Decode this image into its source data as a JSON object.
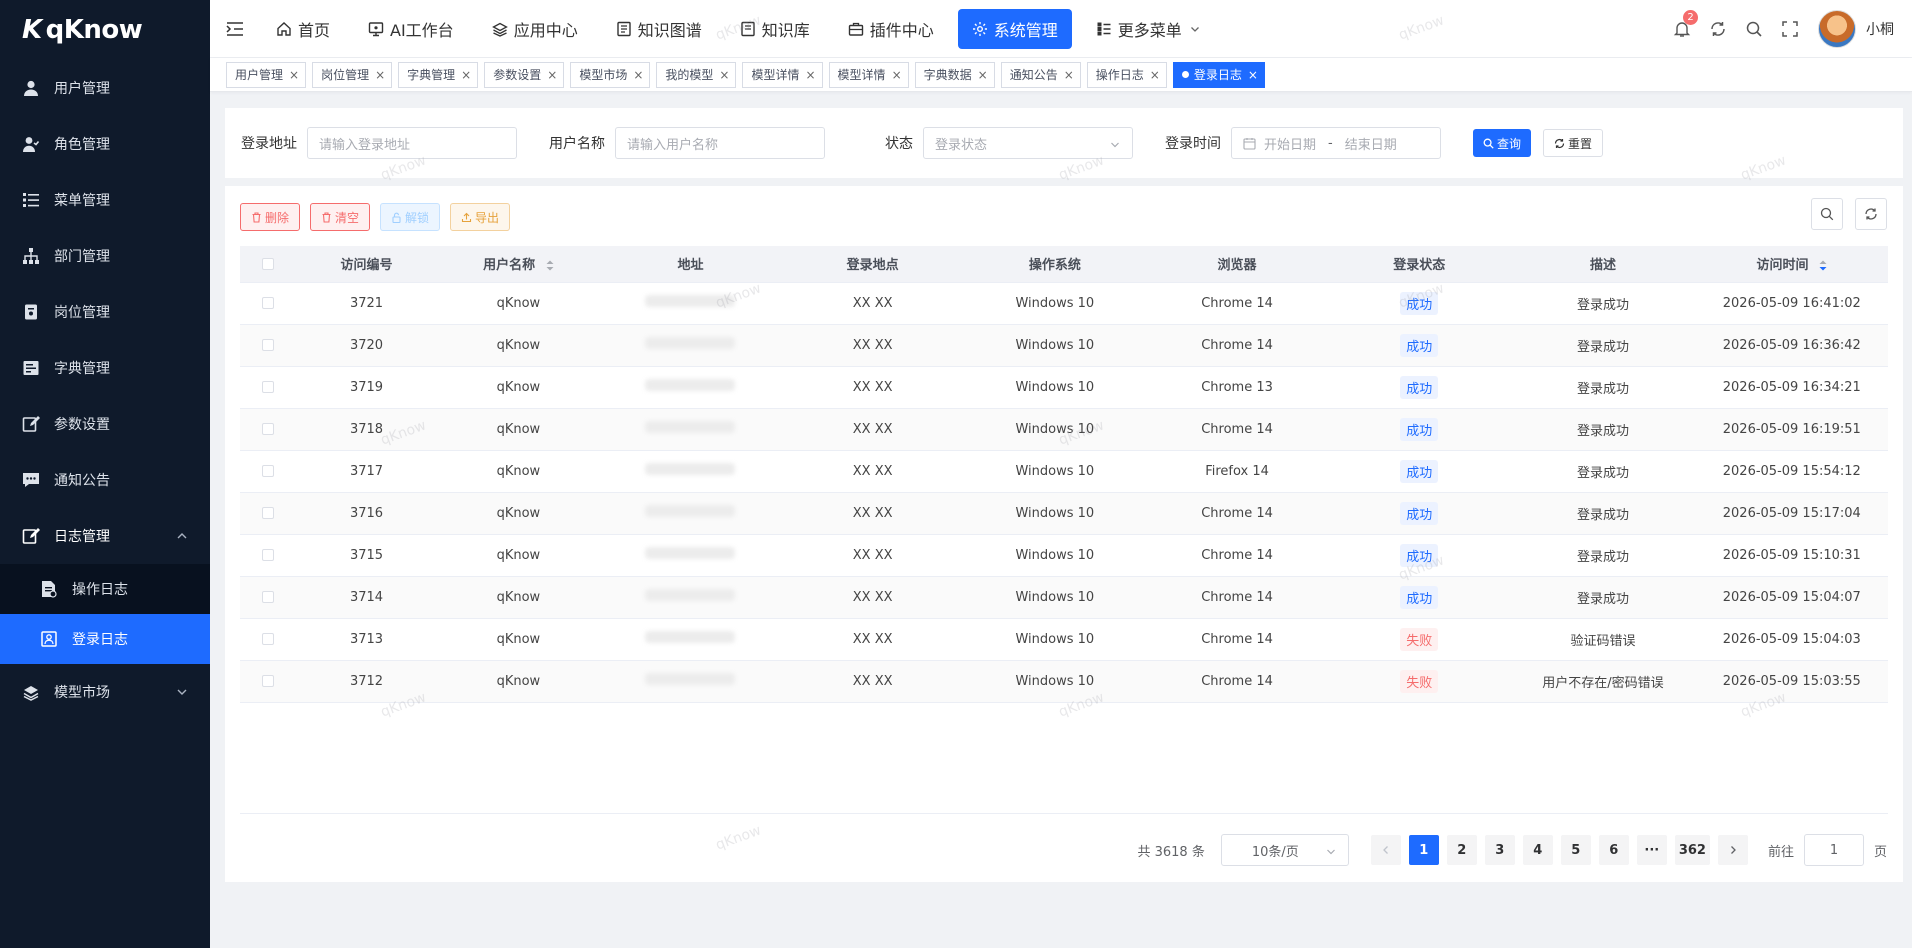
{
  "app": {
    "logo_text": "qKnow",
    "logo_mark": "K"
  },
  "sidebar": {
    "items": [
      {
        "label": "用户管理",
        "icon": "user-icon"
      },
      {
        "label": "角色管理",
        "icon": "role-icon"
      },
      {
        "label": "菜单管理",
        "icon": "menu-icon"
      },
      {
        "label": "部门管理",
        "icon": "department-icon"
      },
      {
        "label": "岗位管理",
        "icon": "post-icon"
      },
      {
        "label": "字典管理",
        "icon": "dictionary-icon"
      },
      {
        "label": "参数设置",
        "icon": "edit-icon"
      },
      {
        "label": "通知公告",
        "icon": "message-icon"
      }
    ],
    "log_group": {
      "label": "日志管理",
      "children": [
        {
          "label": "操作日志"
        },
        {
          "label": "登录日志"
        }
      ]
    },
    "model_market": {
      "label": "模型市场"
    }
  },
  "topnav": {
    "items": [
      {
        "label": "首页"
      },
      {
        "label": "AI工作台"
      },
      {
        "label": "应用中心"
      },
      {
        "label": "知识图谱"
      },
      {
        "label": "知识库"
      },
      {
        "label": "插件中心"
      },
      {
        "label": "系统管理"
      },
      {
        "label": "更多菜单"
      }
    ],
    "notification_count": "2",
    "username": "小桐"
  },
  "tags": [
    "用户管理",
    "岗位管理",
    "字典管理",
    "参数设置",
    "模型市场",
    "我的模型",
    "模型详情",
    "模型详情",
    "字典数据",
    "通知公告",
    "操作日志",
    "登录日志"
  ],
  "filters": {
    "address_label": "登录地址",
    "address_placeholder": "请输入登录地址",
    "username_label": "用户名称",
    "username_placeholder": "请输入用户名称",
    "status_label": "状态",
    "status_placeholder": "登录状态",
    "time_label": "登录时间",
    "start_placeholder": "开始日期",
    "range_sep": "-",
    "end_placeholder": "结束日期",
    "search_label": "查询",
    "reset_label": "重置"
  },
  "toolbar": {
    "delete_label": "删除",
    "clear_label": "清空",
    "unlock_label": "解锁",
    "export_label": "导出"
  },
  "table": {
    "headers": [
      "访问编号",
      "用户名称",
      "地址",
      "登录地点",
      "操作系统",
      "浏览器",
      "登录状态",
      "描述",
      "访问时间"
    ],
    "rows": [
      {
        "id": "3721",
        "user": "qKnow",
        "location": "XX XX",
        "os": "Windows 10",
        "browser": "Chrome 14",
        "status": "成功",
        "ok": true,
        "desc": "登录成功",
        "time": "2026-05-09 16:41:02"
      },
      {
        "id": "3720",
        "user": "qKnow",
        "location": "XX XX",
        "os": "Windows 10",
        "browser": "Chrome 14",
        "status": "成功",
        "ok": true,
        "desc": "登录成功",
        "time": "2026-05-09 16:36:42"
      },
      {
        "id": "3719",
        "user": "qKnow",
        "location": "XX XX",
        "os": "Windows 10",
        "browser": "Chrome 13",
        "status": "成功",
        "ok": true,
        "desc": "登录成功",
        "time": "2026-05-09 16:34:21"
      },
      {
        "id": "3718",
        "user": "qKnow",
        "location": "XX XX",
        "os": "Windows 10",
        "browser": "Chrome 14",
        "status": "成功",
        "ok": true,
        "desc": "登录成功",
        "time": "2026-05-09 16:19:51"
      },
      {
        "id": "3717",
        "user": "qKnow",
        "location": "XX XX",
        "os": "Windows 10",
        "browser": "Firefox 14",
        "status": "成功",
        "ok": true,
        "desc": "登录成功",
        "time": "2026-05-09 15:54:12"
      },
      {
        "id": "3716",
        "user": "qKnow",
        "location": "XX XX",
        "os": "Windows 10",
        "browser": "Chrome 14",
        "status": "成功",
        "ok": true,
        "desc": "登录成功",
        "time": "2026-05-09 15:17:04"
      },
      {
        "id": "3715",
        "user": "qKnow",
        "location": "XX XX",
        "os": "Windows 10",
        "browser": "Chrome 14",
        "status": "成功",
        "ok": true,
        "desc": "登录成功",
        "time": "2026-05-09 15:10:31"
      },
      {
        "id": "3714",
        "user": "qKnow",
        "location": "XX XX",
        "os": "Windows 10",
        "browser": "Chrome 14",
        "status": "成功",
        "ok": true,
        "desc": "登录成功",
        "time": "2026-05-09 15:04:07"
      },
      {
        "id": "3713",
        "user": "qKnow",
        "location": "XX XX",
        "os": "Windows 10",
        "browser": "Chrome 14",
        "status": "失败",
        "ok": false,
        "desc": "验证码错误",
        "time": "2026-05-09 15:04:03"
      },
      {
        "id": "3712",
        "user": "qKnow",
        "location": "XX XX",
        "os": "Windows 10",
        "browser": "Chrome 14",
        "status": "失败",
        "ok": false,
        "desc": "用户不存在/密码错误",
        "time": "2026-05-09 15:03:55"
      }
    ]
  },
  "pagination": {
    "total_text": "共 3618 条",
    "page_size": "10条/页",
    "pages": [
      "1",
      "2",
      "3",
      "4",
      "5",
      "6",
      "···",
      "362"
    ],
    "current": "1",
    "goto_label": "前往",
    "goto_value": "1",
    "page_suffix": "页"
  },
  "watermark": "qKnow",
  "colors": {
    "primary": "#1e6bff",
    "sidebar_bg": "#0f1a2b",
    "danger": "#f56c6c",
    "warning": "#e6a23c"
  }
}
